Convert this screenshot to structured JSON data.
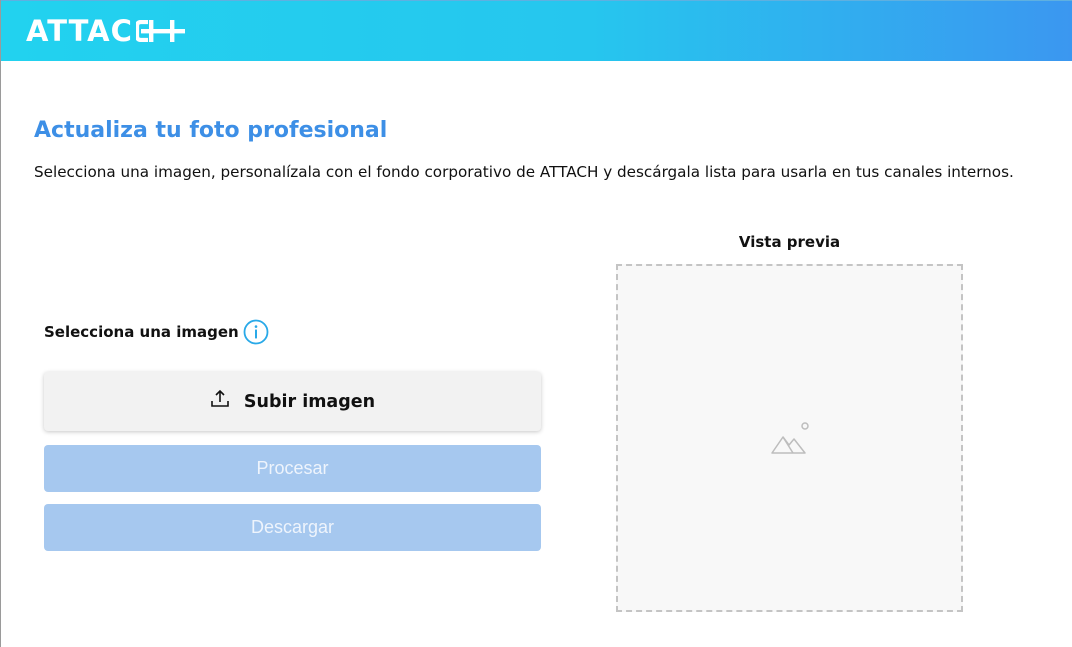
{
  "header": {
    "logo_text": "ATTAC",
    "gradient_start": "#22d2ef",
    "gradient_end": "#3b97f0"
  },
  "main": {
    "title": "Actualiza tu foto profesional",
    "description": "Selecciona una imagen, personalízala con el fondo corporativo de ATTACH y descárgala lista para usarla en tus canales internos.",
    "select_label": "Selecciona una imagen",
    "info_icon": "info-icon",
    "upload_button_label": "Subir imagen",
    "upload_icon": "upload-icon",
    "process_button_label": "Procesar",
    "download_button_label": "Descargar",
    "buttons_disabled_color": "#a6c8ef",
    "accent_color": "#3d8fe6"
  },
  "preview": {
    "label": "Vista previa",
    "placeholder_icon": "image-placeholder-icon"
  }
}
